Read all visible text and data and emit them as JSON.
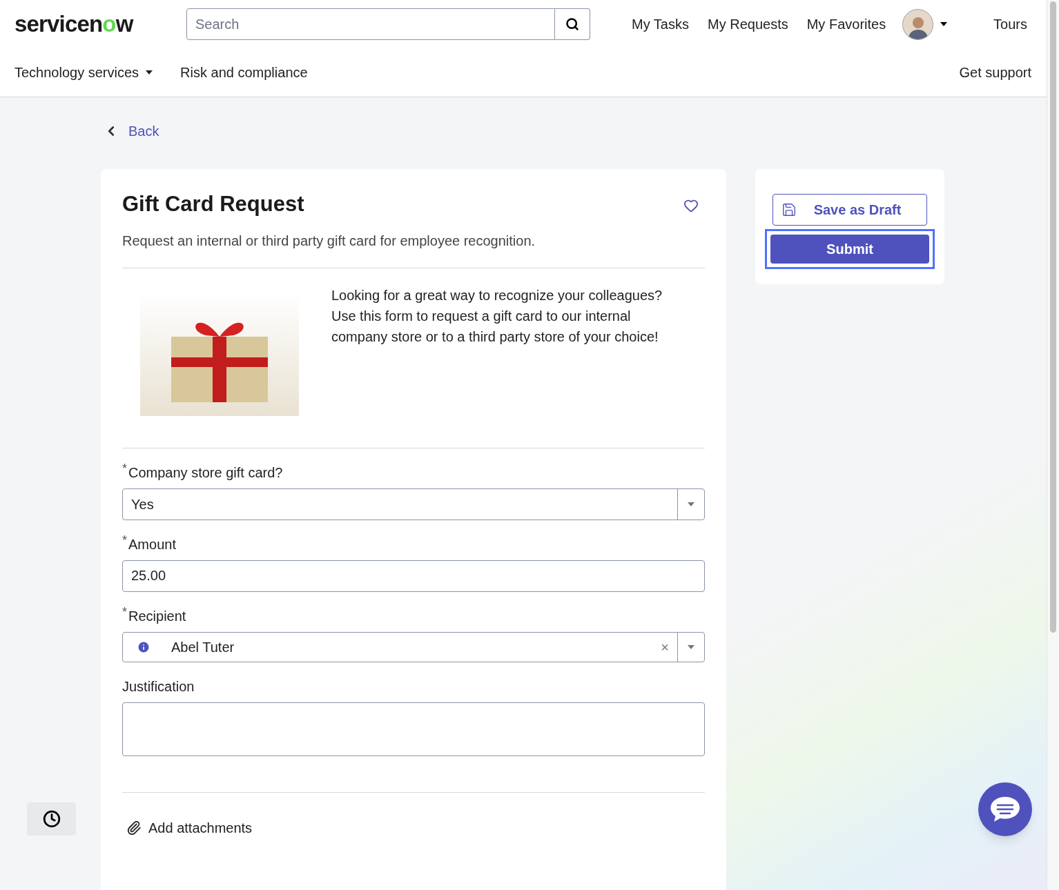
{
  "header": {
    "logo": "servicenow",
    "search": {
      "placeholder": "Search"
    },
    "links": [
      "My Tasks",
      "My Requests",
      "My Favorites"
    ],
    "tours": "Tours"
  },
  "menu": {
    "items": [
      {
        "label": "Technology services",
        "dropdown": true
      },
      {
        "label": "Risk and compliance",
        "dropdown": false
      }
    ],
    "support": "Get support"
  },
  "back": "Back",
  "form": {
    "title": "Gift Card Request",
    "favorite": false,
    "description": "Request an internal or third party gift card for employee recognition.",
    "intro": "Looking for a great way to recognize your colleagues? Use this form to request a gift card to our internal company store or to a third party store of your choice!",
    "fields": [
      {
        "kind": "select",
        "label": "Company store gift card?",
        "required_mark": "*",
        "value": "Yes"
      },
      {
        "kind": "text",
        "label": "Amount",
        "required_mark": "*",
        "value": "25.00"
      },
      {
        "kind": "reference",
        "label": "Recipient",
        "required_mark": "*",
        "value": "Abel Tuter",
        "clear": "×"
      },
      {
        "kind": "textarea",
        "label": "Justification"
      }
    ],
    "attachments": "Add attachments"
  },
  "actions": {
    "draft": "Save as Draft",
    "submit": "Submit"
  }
}
